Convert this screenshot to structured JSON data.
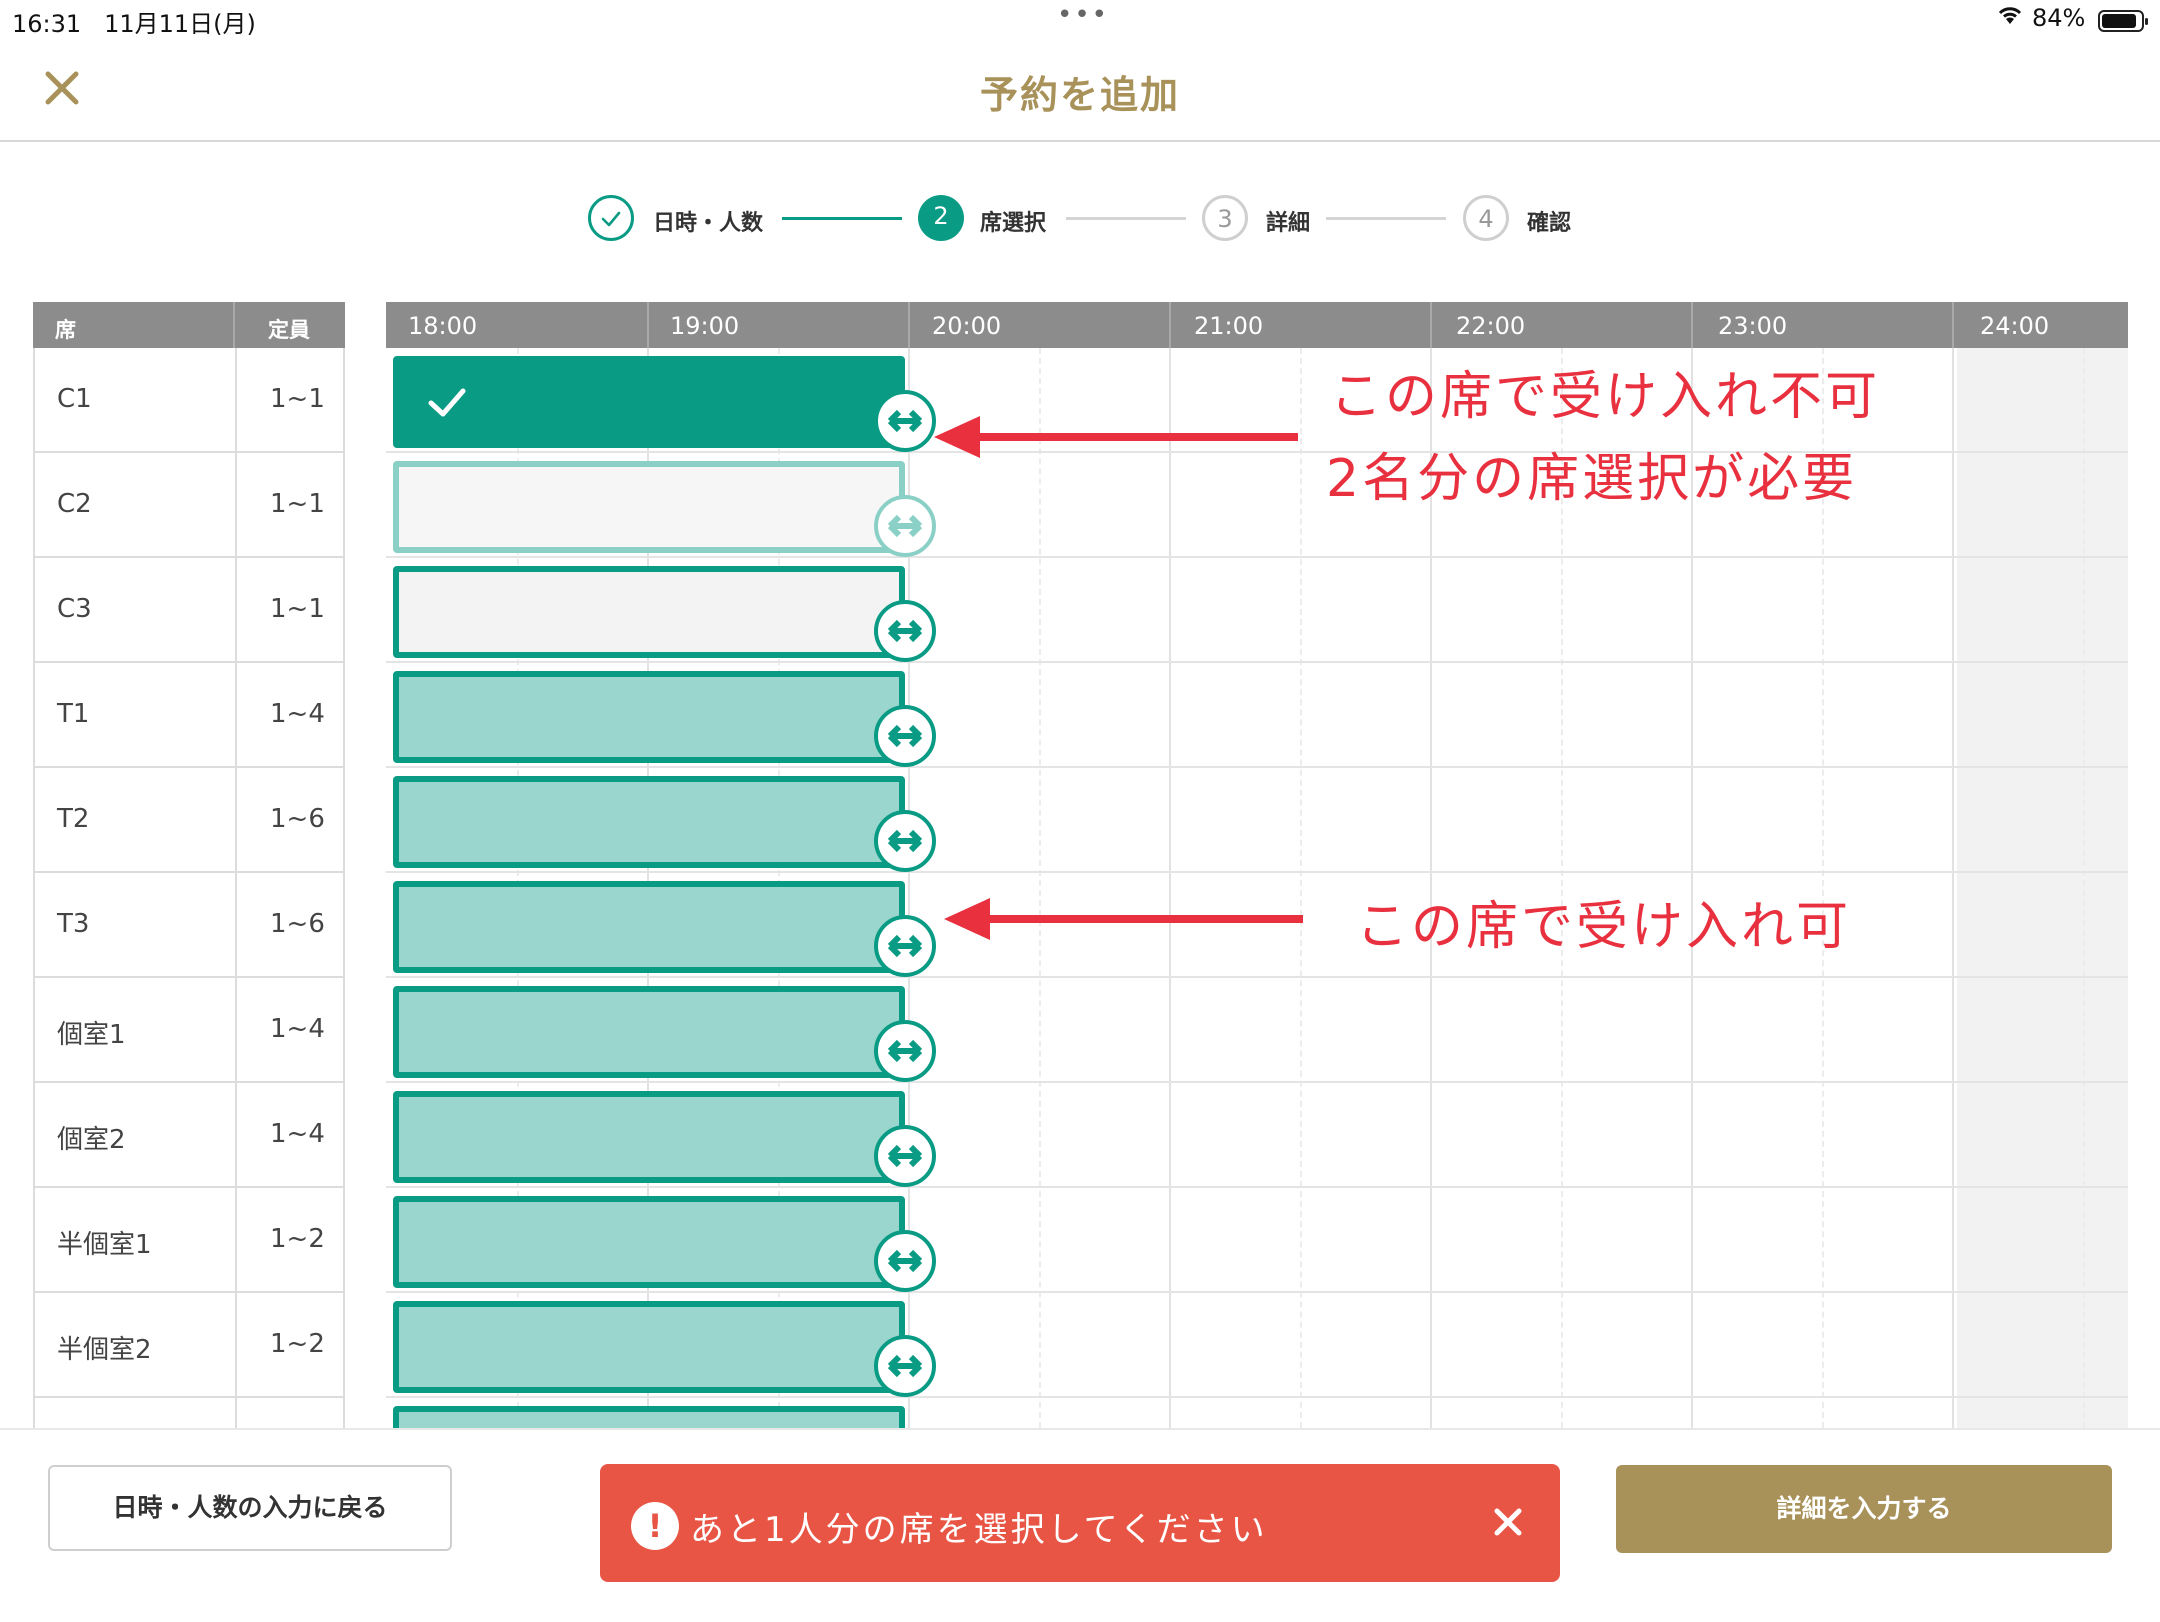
{
  "status_bar": {
    "time": "16:31",
    "date": "11月11日(月)",
    "dots": "•••",
    "battery": "84%"
  },
  "header": {
    "title": "予約を追加",
    "close_icon": "close-icon"
  },
  "steps": [
    {
      "number": "",
      "label": "日時・人数",
      "state": "done"
    },
    {
      "number": "2",
      "label": "席選択",
      "state": "active"
    },
    {
      "number": "3",
      "label": "詳細",
      "state": "todo"
    },
    {
      "number": "4",
      "label": "確認",
      "state": "todo"
    }
  ],
  "seat_table": {
    "headers": {
      "seat": "席",
      "capacity": "定員"
    },
    "rows": [
      {
        "name": "C1",
        "capacity": "1~1",
        "state": "selected"
      },
      {
        "name": "C2",
        "capacity": "1~1",
        "state": "unavailable"
      },
      {
        "name": "C3",
        "capacity": "1~1",
        "state": "disabled"
      },
      {
        "name": "T1",
        "capacity": "1~4",
        "state": "available"
      },
      {
        "name": "T2",
        "capacity": "1~6",
        "state": "available"
      },
      {
        "name": "T3",
        "capacity": "1~6",
        "state": "available"
      },
      {
        "name": "個室1",
        "capacity": "1~4",
        "state": "available"
      },
      {
        "name": "個室2",
        "capacity": "1~4",
        "state": "available"
      },
      {
        "name": "半個室1",
        "capacity": "1~2",
        "state": "available"
      },
      {
        "name": "半個室2",
        "capacity": "1~2",
        "state": "available"
      }
    ]
  },
  "timeline": {
    "hours": [
      "18:00",
      "19:00",
      "20:00",
      "21:00",
      "22:00",
      "23:00",
      "24:00"
    ]
  },
  "annotations": {
    "note1_line1": "この席で受け入れ不可",
    "note1_line2": "2名分の席選択が必要",
    "note2": "この席で受け入れ可"
  },
  "footer": {
    "back_label": "日時・人数の入力に戻る",
    "toast_message": "あと1人分の席を選択してください",
    "next_label": "詳細を入力する"
  },
  "colors": {
    "accent": "#0a9b85",
    "gold": "#a8925a",
    "error": "#e85545",
    "annotation": "#e8303f"
  }
}
